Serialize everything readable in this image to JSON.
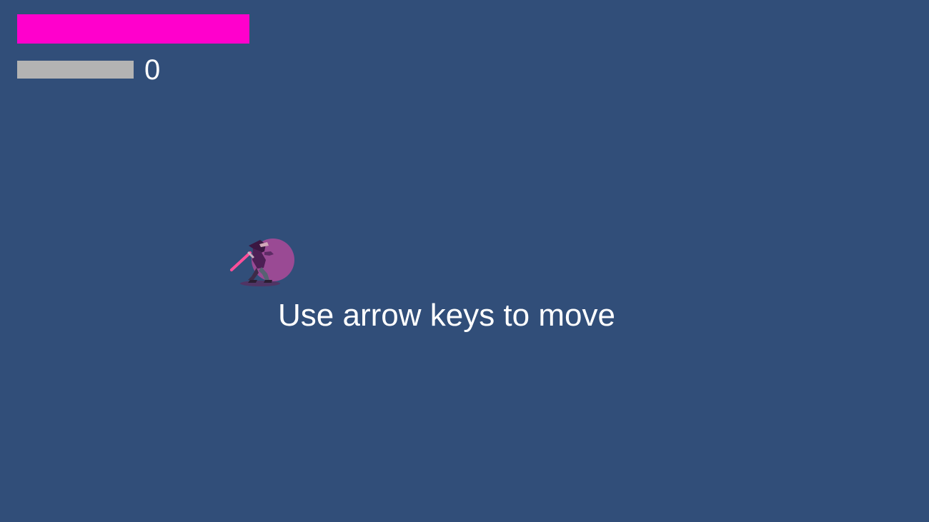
{
  "hud": {
    "health": {
      "level": 1.0,
      "color": "#ff00cc"
    },
    "experience": {
      "level": 1.0,
      "fill_color": "#b3b3b3"
    },
    "score": "0"
  },
  "player": {
    "sprite": "ninja-sprite",
    "aura_color": "#9a4a94",
    "weapon_color": "#ff4f9a"
  },
  "hint": {
    "text": "Use arrow keys to move"
  },
  "background_color": "#314e79"
}
